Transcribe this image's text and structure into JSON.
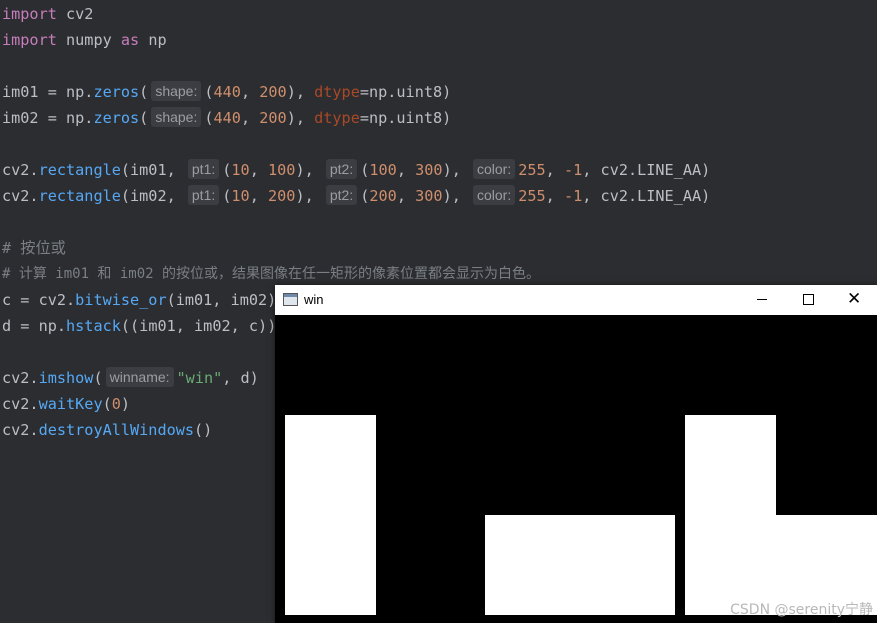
{
  "code_lines": [
    {
      "kind": "import1"
    },
    {
      "kind": "import2"
    }
  ],
  "code": {
    "l1_kw": "import",
    "l1_mod": " cv2",
    "l2_kw": "import",
    "l2_mod": " numpy ",
    "l2_as": "as",
    "l2_alias": " np",
    "l4_a": "im01 = np.",
    "l4_fn": "zeros",
    "l4_b": "(",
    "l4_hint": "shape:",
    "l4_c": "(",
    "l4_n1": "440",
    "l4_d": ", ",
    "l4_n2": "200",
    "l4_e": "), ",
    "l4_kw": "dtype",
    "l4_f": "=np.uint8)",
    "l5_a": "im02 = np.",
    "l5_fn": "zeros",
    "l5_b": "(",
    "l5_hint": "shape:",
    "l5_c": "(",
    "l5_n1": "440",
    "l5_d": ", ",
    "l5_n2": "200",
    "l5_e": "), ",
    "l5_kw": "dtype",
    "l5_f": "=np.uint8)",
    "l7_a": "cv2.",
    "l7_fn": "rectangle",
    "l7_b": "(im01, ",
    "l7_h1": "pt1:",
    "l7_c": "(",
    "l7_n1": "10",
    "l7_d": ", ",
    "l7_n2": "100",
    "l7_e": "), ",
    "l7_h2": "pt2:",
    "l7_f": "(",
    "l7_n3": "100",
    "l7_g": ", ",
    "l7_n4": "300",
    "l7_h": "), ",
    "l7_h3": "color:",
    "l7_n5": "255",
    "l7_i": ", ",
    "l7_n6": "-1",
    "l7_j": ", cv2.LINE_AA)",
    "l8_a": "cv2.",
    "l8_fn": "rectangle",
    "l8_b": "(im02, ",
    "l8_h1": "pt1:",
    "l8_c": "(",
    "l8_n1": "10",
    "l8_d": ", ",
    "l8_n2": "200",
    "l8_e": "), ",
    "l8_h2": "pt2:",
    "l8_f": "(",
    "l8_n3": "200",
    "l8_g": ", ",
    "l8_n4": "300",
    "l8_h": "), ",
    "l8_h3": "color:",
    "l8_n5": "255",
    "l8_i": ", ",
    "l8_n6": "-1",
    "l8_j": ", cv2.LINE_AA)",
    "l10": "# 按位或",
    "l11": "# 计算 im01 和 im02 的按位或，结果图像在任一矩形的像素位置都会显示为白色。",
    "l12_a": "c = cv2.",
    "l12_fn": "bitwise_or",
    "l12_b": "(im01, im02)",
    "l13_a": "d = np.",
    "l13_fn": "hstack",
    "l13_b": "((im01, im02, c))",
    "l15_a": "cv2.",
    "l15_fn": "imshow",
    "l15_b": "(",
    "l15_hint": "winname:",
    "l15_str": "\"win\"",
    "l15_c": ", d)",
    "l16_a": "cv2.",
    "l16_fn": "waitKey",
    "l16_b": "(",
    "l16_n": "0",
    "l16_c": ")",
    "l17_a": "cv2.",
    "l17_fn": "destroyAllWindows",
    "l17_b": "()"
  },
  "window": {
    "title": "win",
    "minimize_label": "",
    "maximize_label": "",
    "close_label": "✕"
  },
  "watermark": "CSDN @serenity宁静",
  "colors": {
    "editor_bg": "#2b2d30",
    "keyword": "#cf8e6d",
    "function": "#56a8f5",
    "number": "#2aacb8",
    "string": "#6aab73",
    "comment": "#7a7e85"
  }
}
